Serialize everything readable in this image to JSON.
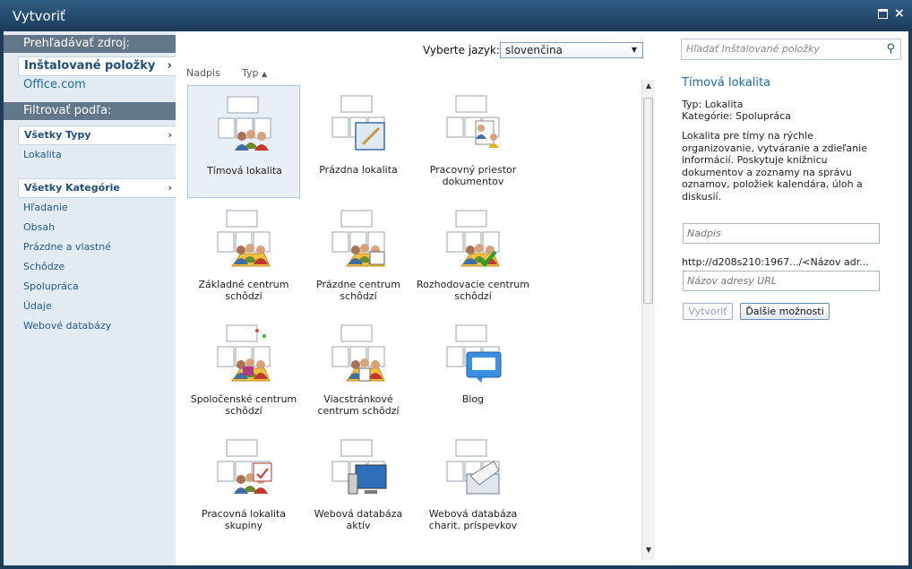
{
  "window": {
    "title": "Vytvoriť"
  },
  "sidebar": {
    "browse_header": "Prehľadávať zdroj:",
    "source_selected": "Inštalované položky",
    "source_other": "Office.com",
    "filter_header": "Filtrovať podľa:",
    "types_selected": "Všetky Typy",
    "types": [
      "Lokalita"
    ],
    "categories_selected": "Všetky Kategórie",
    "categories": [
      "Hľadanie",
      "Obsah",
      "Prázdne a vlastné",
      "Schôdze",
      "Spolupráca",
      "Údaje",
      "Webové databázy"
    ]
  },
  "center": {
    "language_label": "Vyberte jazyk:",
    "language_value": "slovenčina",
    "sort_title": "Nadpis",
    "sort_type": "Typ",
    "sort_arrow": "▲",
    "tiles": [
      "Tímová lokalita",
      "Prázdna lokalita",
      "Pracovný priestor dokumentov",
      "Základné centrum schôdzí",
      "Prázdne centrum schôdzí",
      "Rozhodovacie centrum schôdzí",
      "Spoločenské centrum schôdzí",
      "Viacstránkové centrum schôdzí",
      "Blog",
      "Pracovná lokalita skupiny",
      "Webová databáza aktív",
      "Webová databáza charit. príspevkov"
    ],
    "selected_tile": "Tímová lokalita"
  },
  "details": {
    "search_placeholder": "Hľadať Inštalované položky",
    "title": "Tímová lokalita",
    "type_line": "Typ: Lokalita",
    "category_line": "Kategórie: Spolupráca",
    "description": "Lokalita pre tímy na rýchle organizovanie, vytváranie a zdieľanie informácií. Poskytuje knižnicu dokumentov a zoznamy na správu oznamov, položiek kalendára, úloh a diskusií.",
    "name_placeholder": "Nadpis",
    "url_prefix": "http://d208s210:1967.../<Názov adr...",
    "url_placeholder": "Názov adresy URL",
    "create_button": "Vytvoriť",
    "more_options_button": "Ďalšie možnosti"
  },
  "colors": {
    "accent": "#1f6aa5",
    "title_bar": "#1b3c5a",
    "sidebar_header": "#627789",
    "sidebar_bg": "#e3ebf2"
  }
}
